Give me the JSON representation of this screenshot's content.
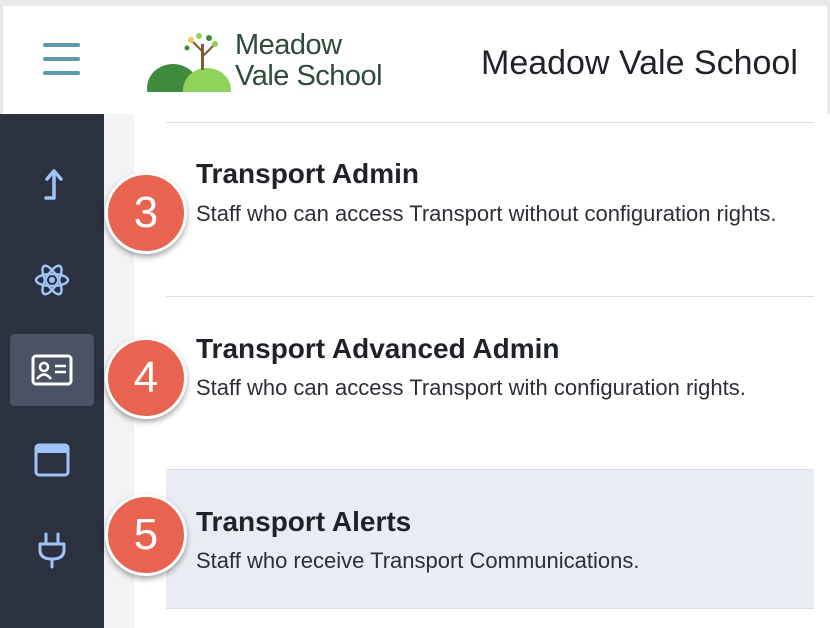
{
  "header": {
    "logo_line1": "Meadow",
    "logo_line2": "Vale School",
    "school_name": "Meadow Vale School"
  },
  "sidebar": {
    "items": [
      {
        "icon": "arrow-up-turn-icon"
      },
      {
        "icon": "atom-icon"
      },
      {
        "icon": "id-card-icon",
        "active": true
      },
      {
        "icon": "browser-window-icon"
      },
      {
        "icon": "plug-icon"
      }
    ]
  },
  "roles": [
    {
      "badge": "3",
      "title": "Transport Admin",
      "description": "Staff who can access Transport without configuration rights."
    },
    {
      "badge": "4",
      "title": "Transport Advanced Admin",
      "description": "Staff who can access Transport with configuration rights."
    },
    {
      "badge": "5",
      "title": "Transport Alerts",
      "description": "Staff who receive Transport Communications."
    }
  ],
  "colors": {
    "accent": "#5b9aa8",
    "badge": "#e86450",
    "sidebar": "#2c3140",
    "highlight_row": "#e9ecf2"
  }
}
